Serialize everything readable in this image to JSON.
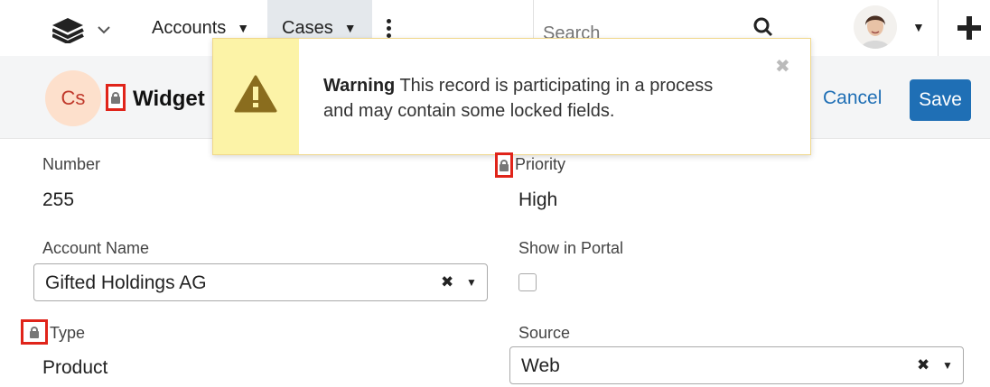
{
  "nav": {
    "accounts": "Accounts",
    "cases": "Cases",
    "search_placeholder": "Search"
  },
  "record": {
    "module_abbr": "Cs",
    "name": "Widget"
  },
  "buttons": {
    "cancel": "Cancel",
    "save": "Save"
  },
  "alert": {
    "title": "Warning",
    "message": "This record is participating in a process and may contain some locked fields."
  },
  "fields": {
    "number": {
      "label": "Number",
      "value": "255"
    },
    "priority": {
      "label": "Priority",
      "value": "High"
    },
    "account_name": {
      "label": "Account Name",
      "value": "Gifted Holdings AG"
    },
    "show_in_portal": {
      "label": "Show in Portal",
      "checked": false
    },
    "type": {
      "label": "Type",
      "value": "Product"
    },
    "source": {
      "label": "Source",
      "value": "Web"
    }
  },
  "colors": {
    "primary": "#1f6fb5",
    "lock_highlight": "#e0241a",
    "warning_bg": "#fcf3a7",
    "warning_icon": "#8a6d1e",
    "module_icon_bg": "#fde0cc"
  },
  "icons": [
    "layers-icon",
    "chevron-down-icon",
    "caret-down-icon",
    "kebab-icon",
    "search-icon",
    "avatar",
    "plus-icon",
    "lock-icon",
    "warning-icon",
    "close-icon",
    "clear-icon"
  ]
}
